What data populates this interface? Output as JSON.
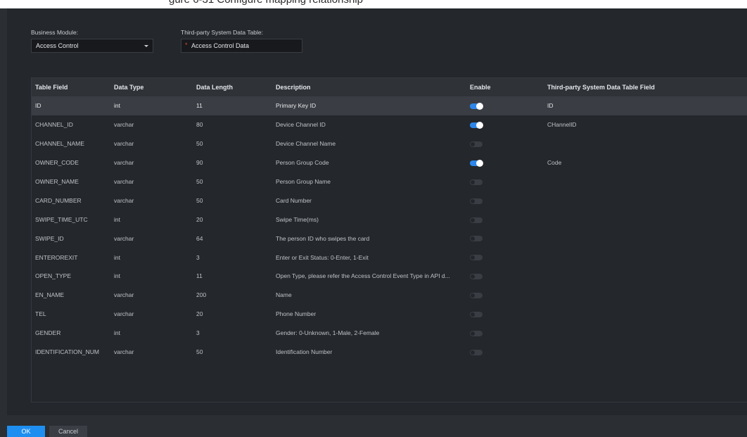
{
  "header_fragment": "gure 6-31 Configure mapping relationship",
  "form": {
    "business_module_label": "Business Module:",
    "business_module_value": "Access Control",
    "third_party_label": "Third-party System Data Table:",
    "third_party_value": "Access Control Data",
    "required_mark": "*"
  },
  "table": {
    "headers": [
      "Table Field",
      "Data Type",
      "Data Length",
      "Description",
      "Enable",
      "Third-party System Data Table Field"
    ],
    "rows": [
      {
        "field": "ID",
        "type": "int",
        "length": "11",
        "desc": "Primary Key ID",
        "enabled": true,
        "mapped": "ID"
      },
      {
        "field": "CHANNEL_ID",
        "type": "varchar",
        "length": "80",
        "desc": "Device Channel ID",
        "enabled": true,
        "mapped": "CHannelID"
      },
      {
        "field": "CHANNEL_NAME",
        "type": "varchar",
        "length": "50",
        "desc": "Device Channel Name",
        "enabled": false,
        "mapped": ""
      },
      {
        "field": "OWNER_CODE",
        "type": "varchar",
        "length": "90",
        "desc": "Person Group Code",
        "enabled": true,
        "mapped": "Code"
      },
      {
        "field": "OWNER_NAME",
        "type": "varchar",
        "length": "50",
        "desc": "Person Group Name",
        "enabled": false,
        "mapped": ""
      },
      {
        "field": "CARD_NUMBER",
        "type": "varchar",
        "length": "50",
        "desc": "Card Number",
        "enabled": false,
        "mapped": ""
      },
      {
        "field": "SWIPE_TIME_UTC",
        "type": "int",
        "length": "20",
        "desc": "Swipe Time(ms)",
        "enabled": false,
        "mapped": ""
      },
      {
        "field": "SWIPE_ID",
        "type": "varchar",
        "length": "64",
        "desc": "The person ID who swipes the card",
        "enabled": false,
        "mapped": ""
      },
      {
        "field": "ENTEROREXIT",
        "type": "int",
        "length": "3",
        "desc": "Enter or Exit Status: 0-Enter, 1-Exit",
        "enabled": false,
        "mapped": ""
      },
      {
        "field": "OPEN_TYPE",
        "type": "int",
        "length": "11",
        "desc": "Open Type, please refer the Access Control Event Type in API d...",
        "enabled": false,
        "mapped": ""
      },
      {
        "field": "EN_NAME",
        "type": "varchar",
        "length": "200",
        "desc": "Name",
        "enabled": false,
        "mapped": ""
      },
      {
        "field": "TEL",
        "type": "varchar",
        "length": "20",
        "desc": "Phone Number",
        "enabled": false,
        "mapped": ""
      },
      {
        "field": "GENDER",
        "type": "int",
        "length": "3",
        "desc": "Gender: 0-Unknown, 1-Male, 2-Female",
        "enabled": false,
        "mapped": ""
      },
      {
        "field": "IDENTIFICATION_NUM",
        "type": "varchar",
        "length": "50",
        "desc": "Identification Number",
        "enabled": false,
        "mapped": ""
      }
    ]
  },
  "footer": {
    "ok_label": "OK",
    "cancel_label": "Cancel"
  },
  "colors": {
    "accent": "#1e8ff0",
    "toggle_on": "#2d86ea",
    "required": "#e0453d"
  }
}
